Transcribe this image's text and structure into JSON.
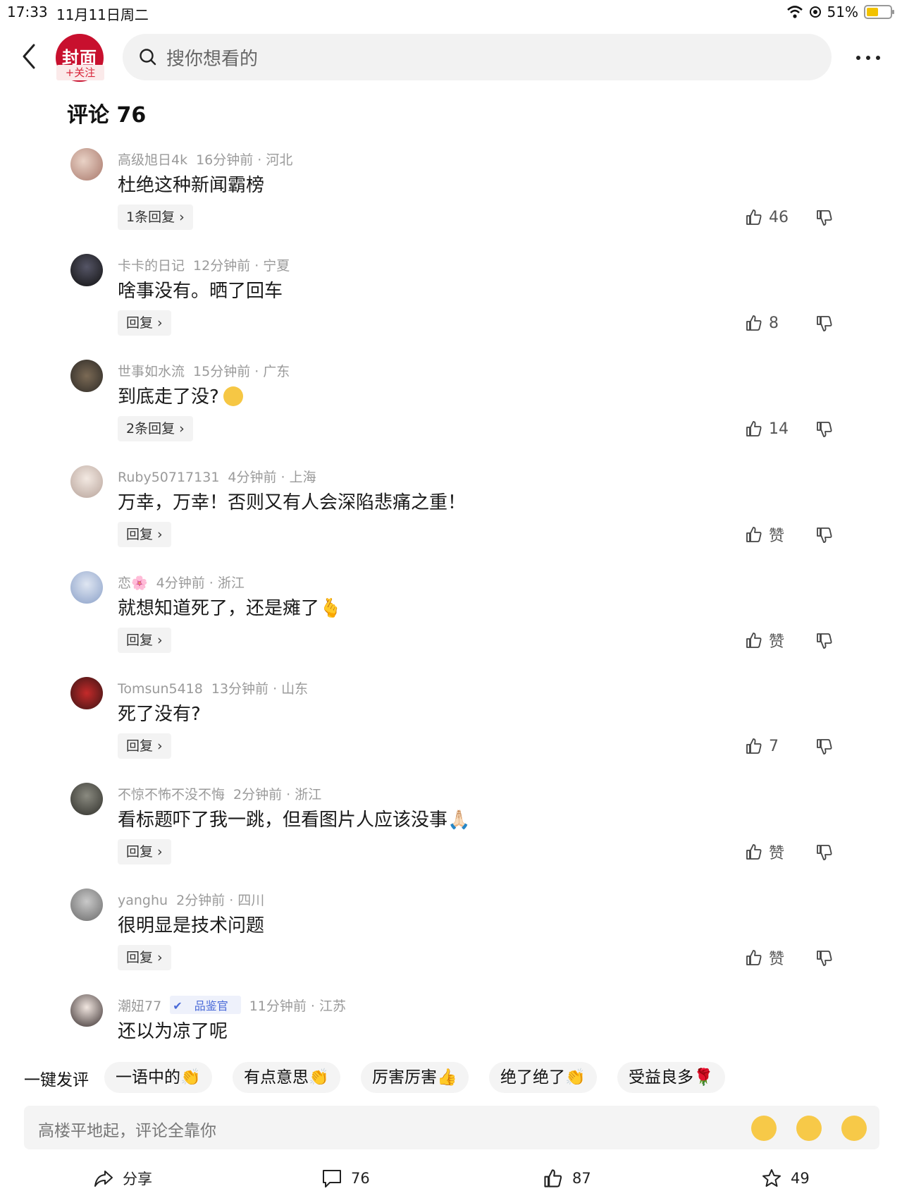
{
  "status_bar": {
    "time": "17:33",
    "date": "11月11日周二",
    "battery": "51%",
    "battery_level": 0.51
  },
  "header": {
    "logo_text": "封面",
    "follow_label": "+关注",
    "search_placeholder": "搜你想看的"
  },
  "comments_title": "评论 76",
  "comments": [
    {
      "user": "高级旭日4k",
      "time": "16分钟前 · 河北",
      "text": "杜绝这种新闻霸榜",
      "reply": "1条回复 ›",
      "likes": "46"
    },
    {
      "user": "卡卡的日记",
      "time": "12分钟前 · 宁夏",
      "text": "啥事没有。晒了回车",
      "reply": "回复 ›",
      "likes": "8"
    },
    {
      "user": "世事如水流",
      "time": "15分钟前 · 广东",
      "text": "到底走了没?",
      "reply": "2条回复 ›",
      "likes": "14"
    },
    {
      "user": "Ruby50717131",
      "time": "4分钟前 · 上海",
      "text": "万幸，万幸！否则又有人会深陷悲痛之重！",
      "reply": "回复 ›",
      "likes": "赞"
    },
    {
      "user": "恋🌸",
      "time": "4分钟前 · 浙江",
      "text": "就想知道死了，还是瘫了🫰",
      "reply": "回复 ›",
      "likes": "赞"
    },
    {
      "user": "Tomsun5418",
      "time": "13分钟前 · 山东",
      "text": "死了没有?",
      "reply": "回复 ›",
      "likes": "7"
    },
    {
      "user": "不惊不怖不没不悔",
      "time": "2分钟前 · 浙江",
      "text": "看标题吓了我一跳，但看图片人应该没事🙏🏻",
      "reply": "回复 ›",
      "likes": "赞"
    },
    {
      "user": "yanghu",
      "time": "2分钟前 · 四川",
      "text": "很明显是技术问题",
      "reply": "回复 ›",
      "likes": "赞"
    },
    {
      "user": "潮妞77",
      "badge": "品鉴官",
      "time": "11分钟前 · 江苏",
      "text": "还以为凉了呢"
    }
  ],
  "quick_comment": {
    "label": "一键发评",
    "chips": [
      "一语中的👏",
      "有点意思👏",
      "厉害厉害👍",
      "绝了绝了👏",
      "受益良多🌹"
    ]
  },
  "input": {
    "placeholder": "高楼平地起，评论全靠你"
  },
  "bottom_bar": {
    "share": "分享",
    "comments": "76",
    "likes": "87",
    "favorites": "49"
  },
  "colors": {
    "brand_red": "#c8102e",
    "follow_red": "#d8263a",
    "badge_blue": "#4a6ad8"
  }
}
